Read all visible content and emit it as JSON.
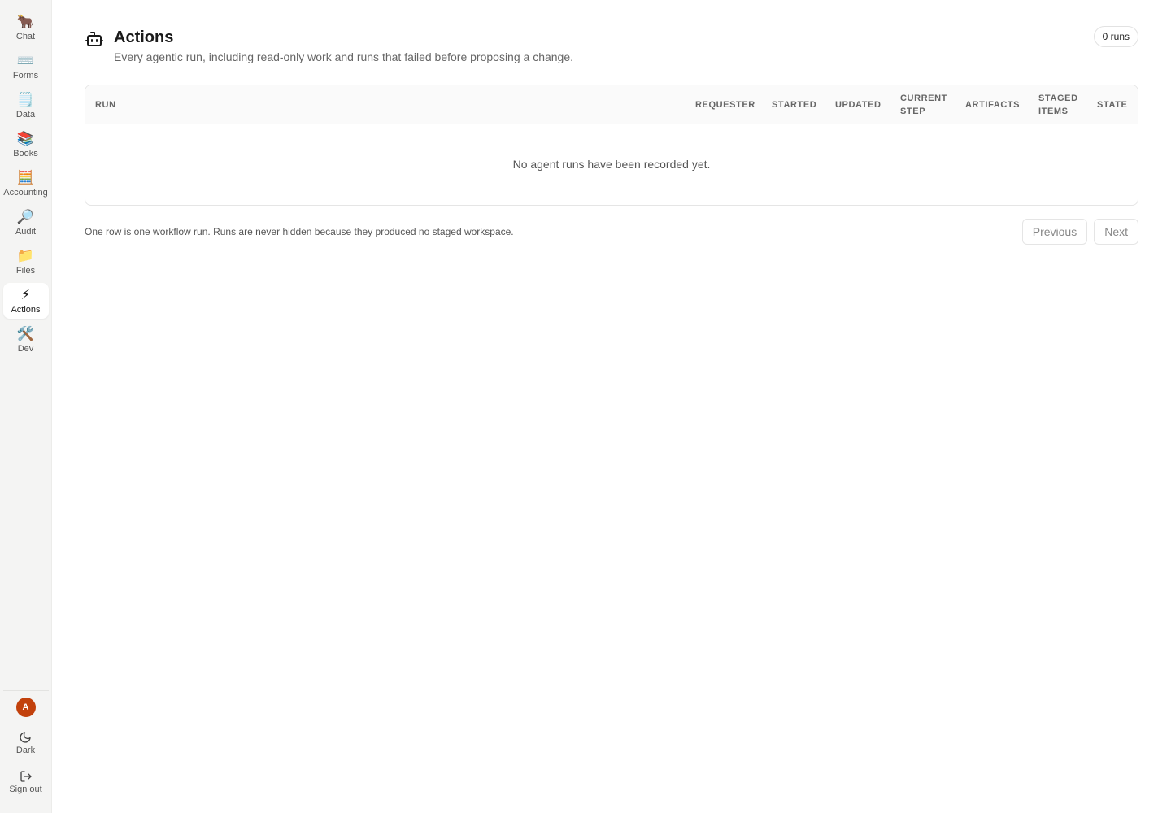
{
  "sidebar": {
    "items": [
      {
        "label": "Chat",
        "icon": "🐂",
        "icon_name": "ox-icon",
        "active": false
      },
      {
        "label": "Forms",
        "icon": "⌨️",
        "icon_name": "keyboard-icon",
        "active": false
      },
      {
        "label": "Data",
        "icon": "🗒️",
        "icon_name": "notepad-icon",
        "active": false
      },
      {
        "label": "Books",
        "icon": "📚",
        "icon_name": "books-icon",
        "active": false
      },
      {
        "label": "Accounting",
        "icon": "🧮",
        "icon_name": "abacus-icon",
        "active": false
      },
      {
        "label": "Audit",
        "icon": "🔎",
        "icon_name": "magnifier-icon",
        "active": false
      },
      {
        "label": "Files",
        "icon": "📁",
        "icon_name": "folder-icon",
        "active": false
      },
      {
        "label": "Actions",
        "icon": "⚡",
        "icon_name": "lightning-icon",
        "active": true
      },
      {
        "label": "Dev",
        "icon": "🛠️",
        "icon_name": "tools-icon",
        "active": false
      }
    ],
    "avatar_initial": "A",
    "theme_label": "Dark",
    "signout_label": "Sign out"
  },
  "header": {
    "title": "Actions",
    "subtitle": "Every agentic run, including read-only work and runs that failed before proposing a change.",
    "count": "0 runs"
  },
  "table": {
    "columns": [
      "RUN",
      "REQUESTER",
      "STARTED",
      "UPDATED",
      "CURRENT STEP",
      "ARTIFACTS",
      "STAGED ITEMS",
      "STATE"
    ],
    "rows": [],
    "empty_message": "No agent runs have been recorded yet."
  },
  "footer": {
    "note": "One row is one workflow run. Runs are never hidden because they produced no staged workspace.",
    "previous_label": "Previous",
    "next_label": "Next"
  },
  "colors": {
    "accent_avatar": "#c2410c",
    "sidebar_bg": "#f4f4f3"
  }
}
